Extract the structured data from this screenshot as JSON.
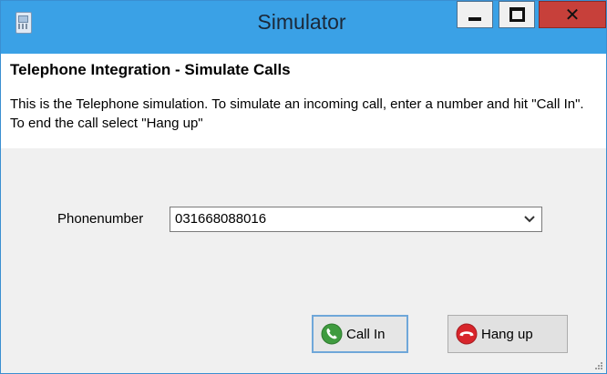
{
  "window": {
    "title": "Simulator",
    "controls": {
      "minimize": "minimize-icon",
      "maximize": "maximize-icon",
      "close": "close-icon"
    },
    "accent_color": "#3aa1e6",
    "close_color": "#c7403a"
  },
  "header": {
    "title": "Telephone Integration - Simulate Calls",
    "description": "This is the Telephone simulation. To simulate an incoming call, enter a number  and hit \"Call In\". To end the call select \"Hang up\""
  },
  "form": {
    "phone_label": "Phonenumber",
    "phone_value": "031668088016"
  },
  "buttons": {
    "call_in": {
      "label": "Call In",
      "icon": "phone-answer-icon",
      "icon_color": "#3f9b3f"
    },
    "hang_up": {
      "label": "Hang up",
      "icon": "phone-hangup-icon",
      "icon_color": "#d8252b"
    }
  }
}
